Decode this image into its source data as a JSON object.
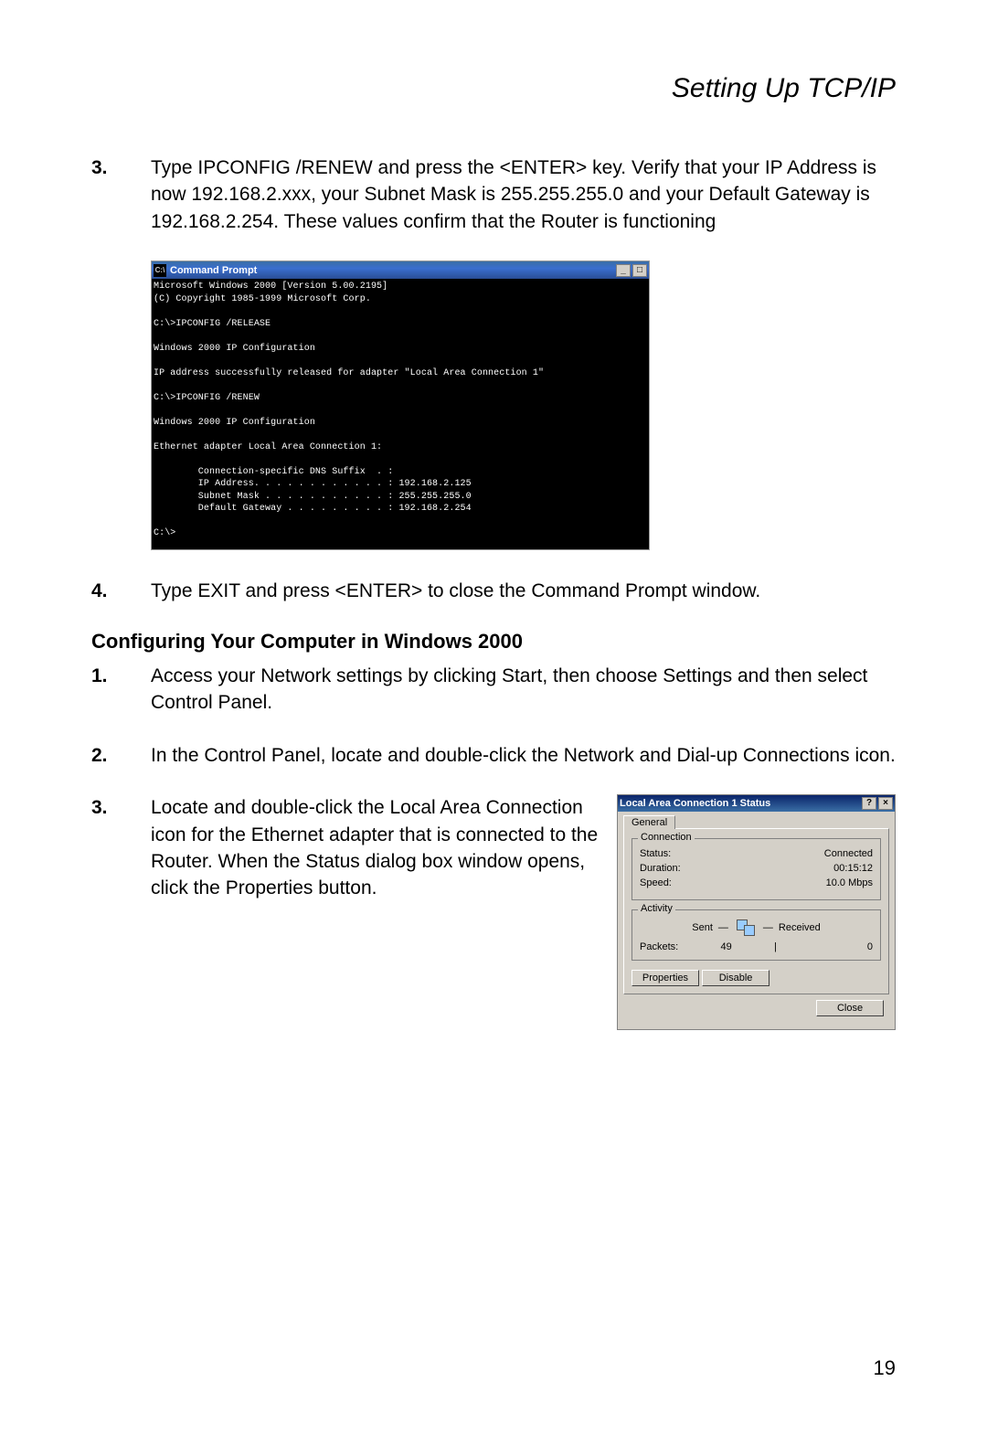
{
  "pageTitle": "Setting Up TCP/IP",
  "pageNumber": "19",
  "step3": {
    "num": "3.",
    "text": "Type IPCONFIG /RENEW and press the <ENTER> key. Verify that your IP Address is now 192.168.2.xxx, your Subnet Mask is 255.255.255.0 and your Default Gateway is 192.168.2.254. These values confirm that the Router is functioning"
  },
  "cmd": {
    "title": "Command Prompt",
    "body": "Microsoft Windows 2000 [Version 5.00.2195]\n(C) Copyright 1985-1999 Microsoft Corp.\n\nC:\\>IPCONFIG /RELEASE\n\nWindows 2000 IP Configuration\n\nIP address successfully released for adapter \"Local Area Connection 1\"\n\nC:\\>IPCONFIG /RENEW\n\nWindows 2000 IP Configuration\n\nEthernet adapter Local Area Connection 1:\n\n        Connection-specific DNS Suffix  . :\n        IP Address. . . . . . . . . . . . : 192.168.2.125\n        Subnet Mask . . . . . . . . . . . : 255.255.255.0\n        Default Gateway . . . . . . . . . : 192.168.2.254\n\nC:\\>"
  },
  "step4": {
    "num": "4.",
    "text": "Type EXIT and press <ENTER> to close the Command Prompt window."
  },
  "sectionHead": "Configuring Your Computer in Windows 2000",
  "w1": {
    "num": "1.",
    "text": "Access your Network settings by clicking Start, then choose Settings and then select Control Panel."
  },
  "w2": {
    "num": "2.",
    "text": "In the Control Panel, locate and double-click the Network and Dial-up Connections icon."
  },
  "w3": {
    "num": "3.",
    "text": "Locate and double-click the Local Area Connection icon for the Ethernet adapter that is connected to the Router. When the Status dialog box window opens, click the Properties button."
  },
  "dialog": {
    "title": "Local Area Connection 1 Status",
    "tabGeneral": "General",
    "connection": {
      "groupLabel": "Connection",
      "statusLabel": "Status:",
      "statusValue": "Connected",
      "durationLabel": "Duration:",
      "durationValue": "00:15:12",
      "speedLabel": "Speed:",
      "speedValue": "10.0 Mbps"
    },
    "activity": {
      "groupLabel": "Activity",
      "sentLabel": "Sent",
      "receivedLabel": "Received",
      "packetsLabel": "Packets:",
      "sentValue": "49",
      "receivedValue": "0"
    },
    "buttons": {
      "properties": "Properties",
      "disable": "Disable",
      "close": "Close"
    }
  }
}
